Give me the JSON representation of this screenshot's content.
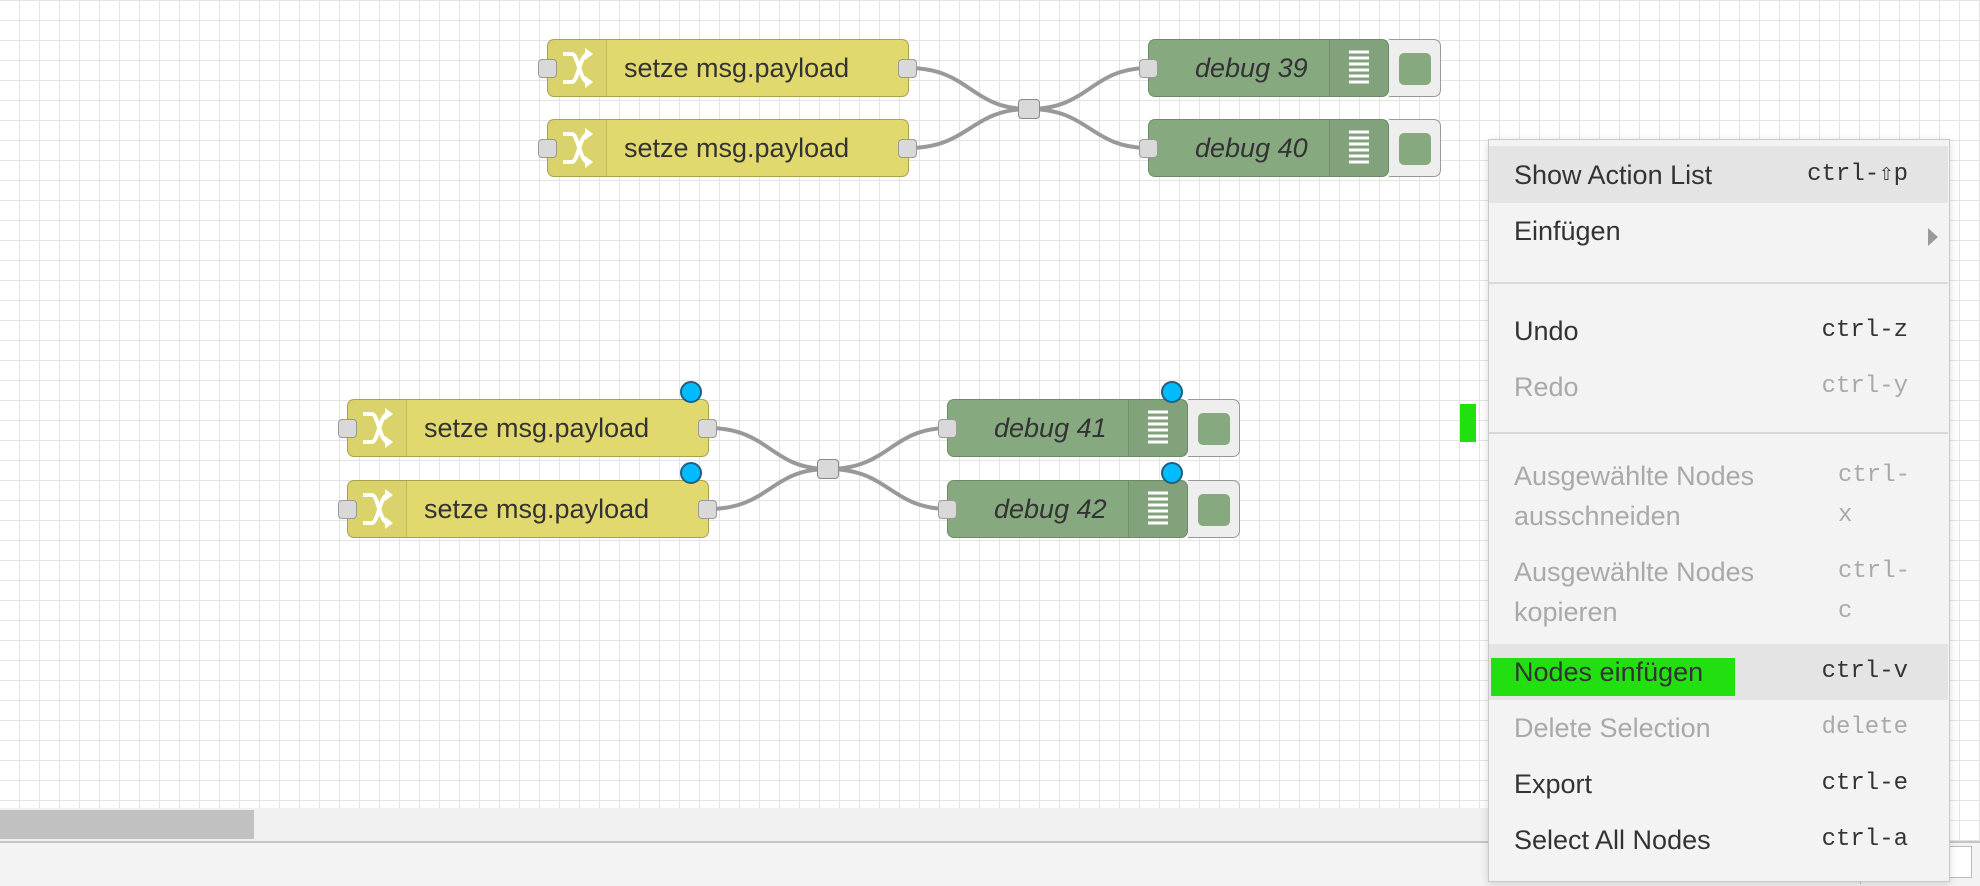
{
  "workspace": {
    "colors": {
      "change_node": "#e2d96e",
      "debug_node": "#87a980",
      "changed_dot": "#00bcff",
      "highlight": "#22e010"
    },
    "nodes": {
      "change_1": {
        "label": "setze msg.payload",
        "icon": "shuffle-icon"
      },
      "change_2": {
        "label": "setze msg.payload",
        "icon": "shuffle-icon"
      },
      "change_3": {
        "label": "setze msg.payload",
        "icon": "shuffle-icon",
        "changed": true
      },
      "change_4": {
        "label": "setze msg.payload",
        "icon": "shuffle-icon",
        "changed": true
      },
      "debug_1": {
        "label": "debug 39",
        "icon": "list-icon"
      },
      "debug_2": {
        "label": "debug 40",
        "icon": "list-icon"
      },
      "debug_3": {
        "label": "debug 41",
        "icon": "list-icon",
        "changed": true
      },
      "debug_4": {
        "label": "debug 42",
        "icon": "list-icon",
        "changed": true
      }
    }
  },
  "context_menu": {
    "items": [
      {
        "label": "Show Action List",
        "shortcut": "ctrl-⇧p",
        "disabled": false
      },
      {
        "label": "Einfügen",
        "shortcut": "",
        "submenu": true,
        "disabled": false
      },
      {
        "label": "Undo",
        "shortcut": "ctrl-z",
        "disabled": false
      },
      {
        "label": "Redo",
        "shortcut": "ctrl-y",
        "disabled": true
      },
      {
        "label_line1": "Ausgewählte Nodes",
        "label_line2": "ausschneiden",
        "shortcut_line1": "ctrl-",
        "shortcut_line2": "x",
        "disabled": true
      },
      {
        "label_line1": "Ausgewählte Nodes",
        "label_line2": "kopieren",
        "shortcut_line1": "ctrl-",
        "shortcut_line2": "c",
        "disabled": true
      },
      {
        "label": "Nodes einfügen",
        "shortcut": "ctrl-v",
        "disabled": false
      },
      {
        "label": "Delete Selection",
        "shortcut": "delete",
        "disabled": true
      },
      {
        "label": "Export",
        "shortcut": "ctrl-e",
        "disabled": false
      },
      {
        "label": "Select All Nodes",
        "shortcut": "ctrl-a",
        "disabled": false
      }
    ]
  }
}
